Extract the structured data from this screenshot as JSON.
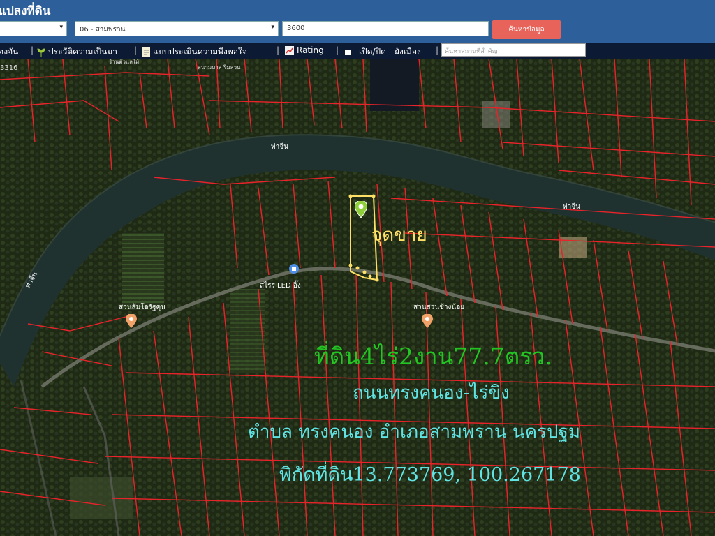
{
  "header": {
    "title": "แปลงที่ดิน",
    "province_select": "",
    "district_select": "06 - สามพราน",
    "parcel_input": "3600",
    "search_button": "ค้นหาข้อมูล"
  },
  "toolbar": {
    "item1": "องจัน",
    "item2": "ประวัติความเป็นมา",
    "item3": "แบบประเมินความพึงพอใจ",
    "item4": "Rating",
    "item5": "เปิด/ปิด - ผังเมือง",
    "search_placeholder": "ค้นหาสถานที่สำคัญ"
  },
  "map": {
    "labels": {
      "river_1": "ท่าจีน",
      "river_2": "ท่าจีน",
      "river_3": "ท่าจีน",
      "road_top_left": "3316",
      "place_top": "ร้านตัวแลไม้",
      "place_top2": "สนามบาส ริมสวน",
      "place_led": "สไรร LED อิ๊ง",
      "place_garden1": "สวนส้มโอรัฐคุน",
      "place_garden2": "สวนสวนช้างน้อย",
      "sale_label": "จุดขาย"
    },
    "overlay": {
      "line1": "ที่ดิน4ไร่2งาน77.7ตรว.",
      "line2": "ถนนทรงคนอง-ไร่ขิง",
      "line3": "ตำบล ทรงคนอง อำเภอสามพราน นครปฐม",
      "line4": "พิกัดที่ดิน13.773769, 100.267178"
    }
  },
  "colors": {
    "header_bg": "#2d5f9b",
    "toolbar_bg": "#0c1a33",
    "search_btn": "#e8645a",
    "parcel_lines": "#e8232a",
    "highlight": "#ffe066",
    "overlay_green": "#22c522",
    "overlay_cyan": "#5fe3e3"
  }
}
